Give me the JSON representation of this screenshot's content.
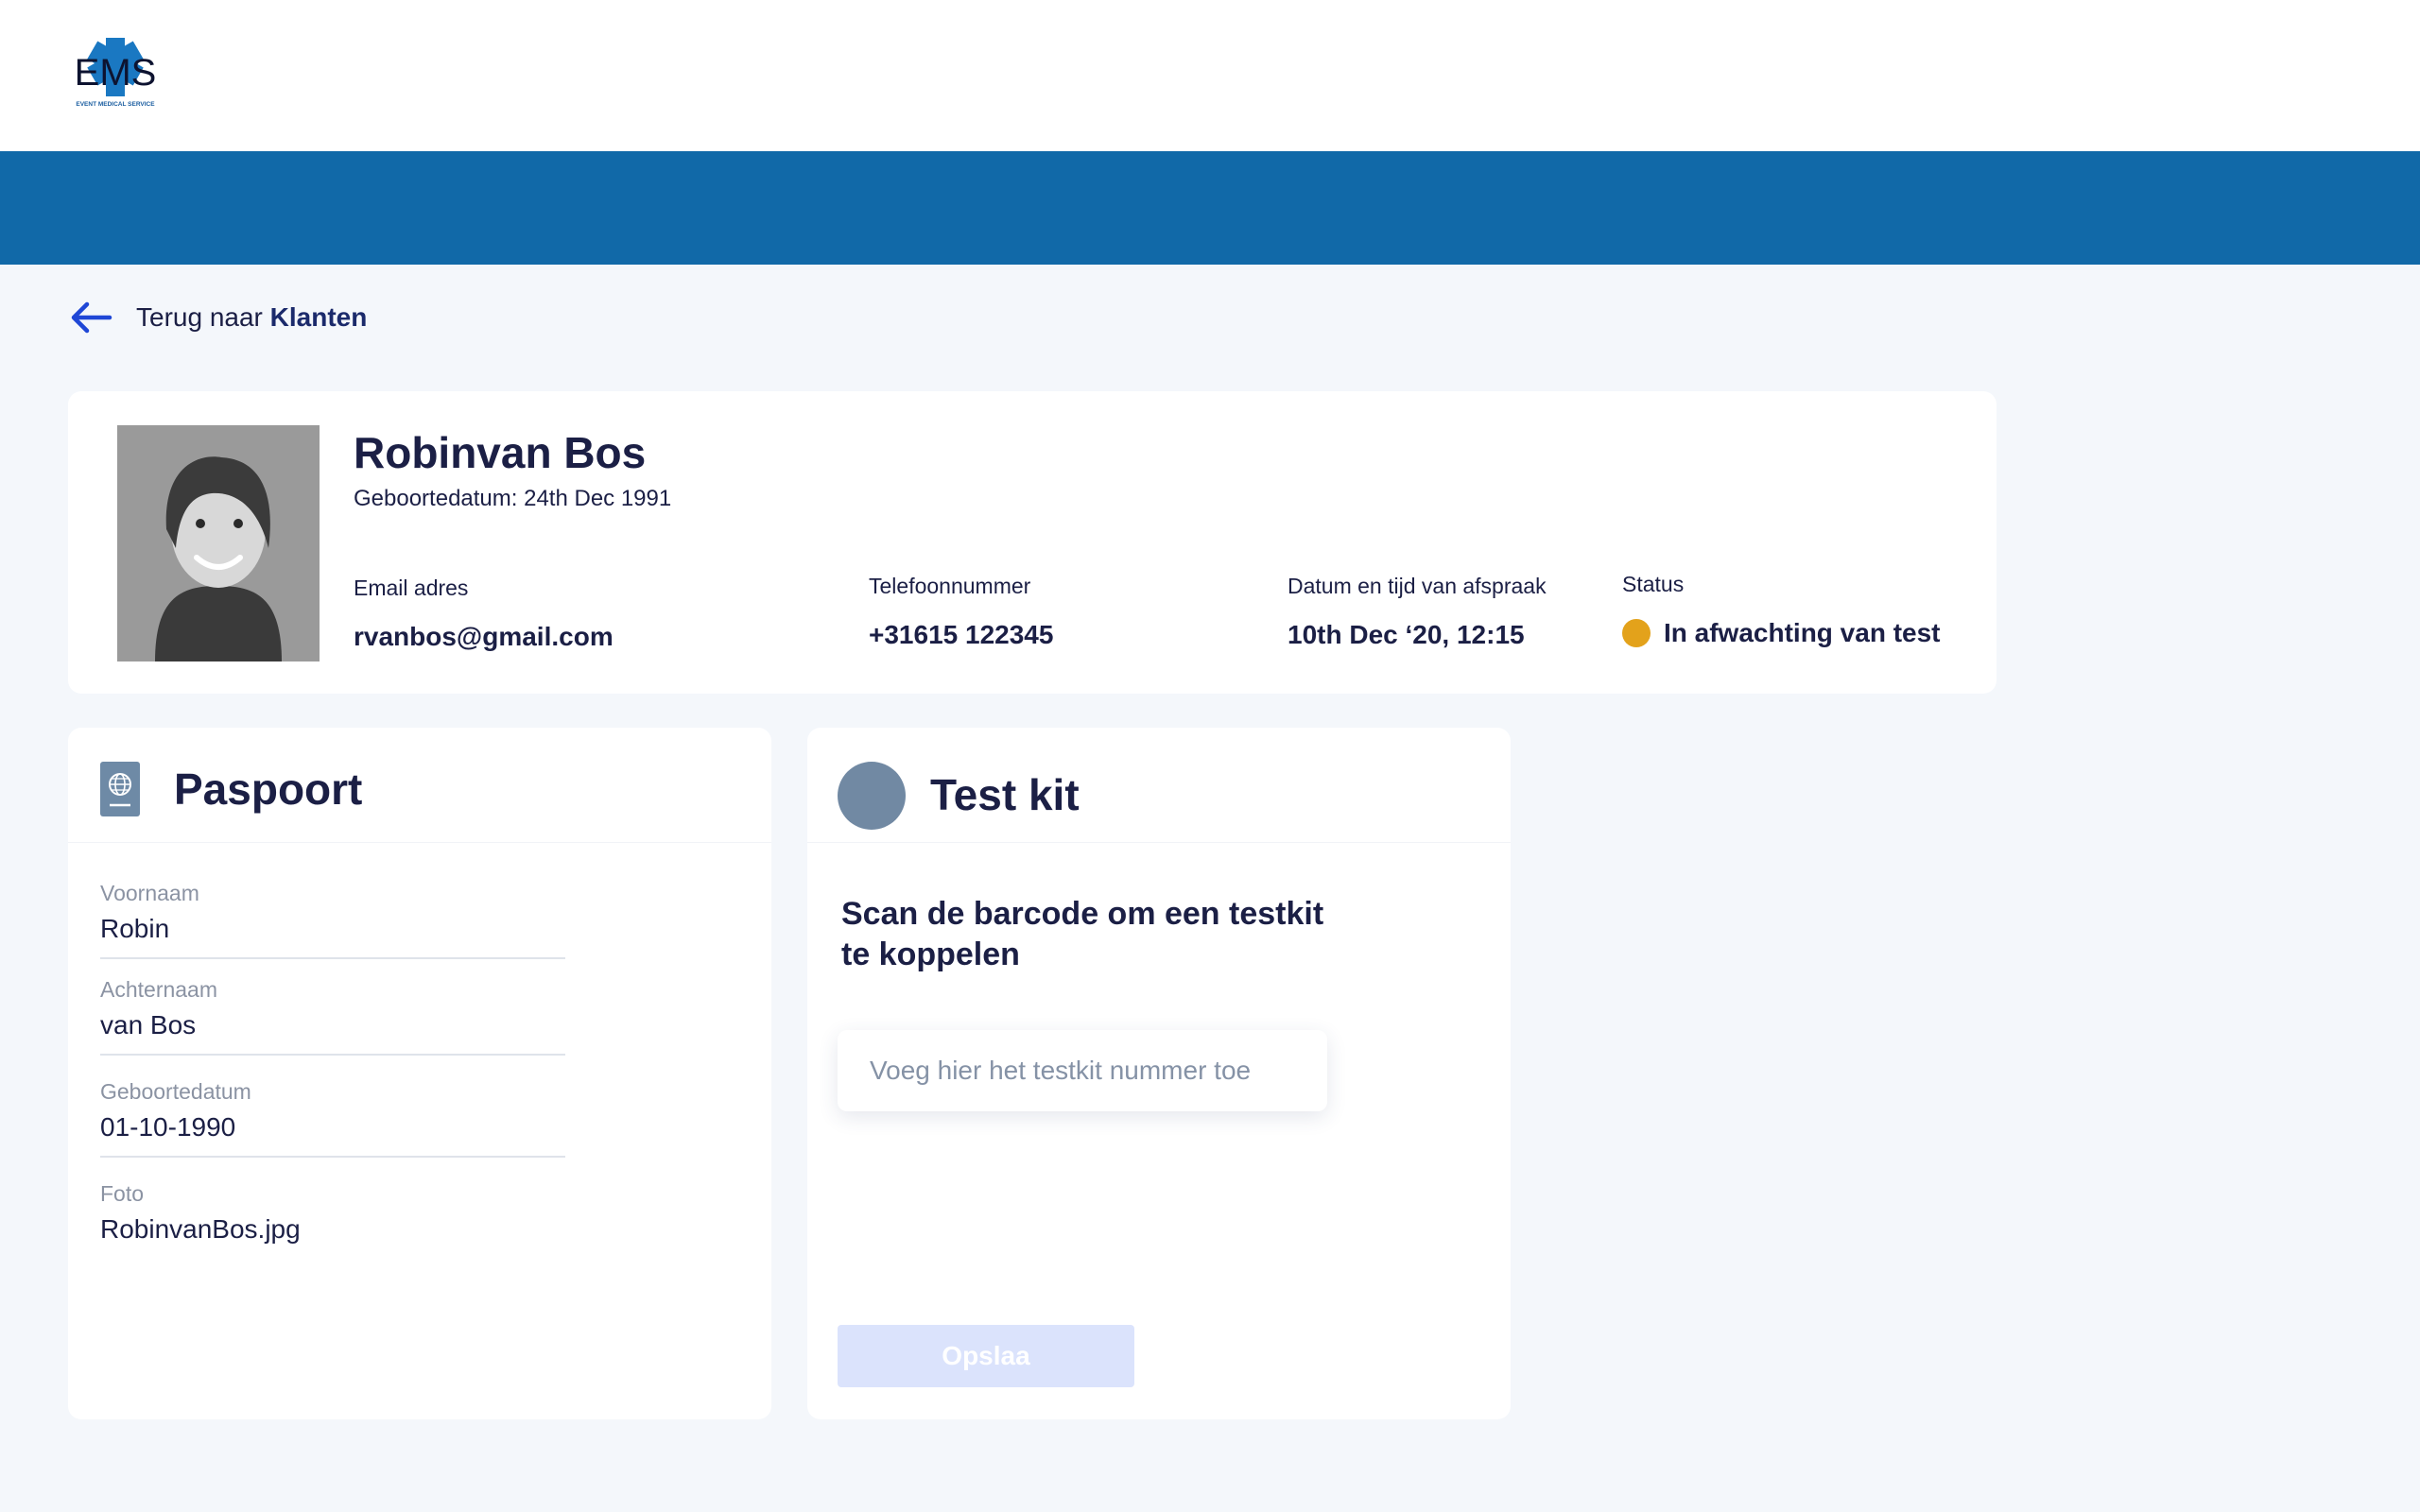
{
  "header": {
    "logo_text": "EMS",
    "logo_subtext": "EVENT MEDICAL SERVICE"
  },
  "back_link": {
    "prefix": "Terug naar",
    "target": "Klanten"
  },
  "profile": {
    "name": "Robinvan Bos",
    "dob_line": "Geboortedatum: 24th Dec  1991",
    "email_label": "Email adres",
    "email_value": "rvanbos@gmail.com",
    "phone_label": "Telefoonnummer",
    "phone_value": "+31615 122345",
    "appointment_label": "Datum en tijd van afspraak",
    "appointment_value": "10th Dec  ‘20, 12:15",
    "status_label": "Status",
    "status_value": "In afwachting van test",
    "status_color": "#e3a21b"
  },
  "passport": {
    "title": "Paspoort",
    "icon": "passport-icon",
    "fields": [
      {
        "label": "Voornaam",
        "value": "Robin"
      },
      {
        "label": "Achternaam",
        "value": "van Bos"
      },
      {
        "label": "Geboortedatum",
        "value": "01-10-1990"
      },
      {
        "label": "Foto",
        "value": "RobinvanBos.jpg"
      }
    ]
  },
  "testkit": {
    "title": "Test kit",
    "heading": "Scan de barcode om een testkit te koppelen",
    "input_placeholder": "Voeg hier het testkit nummer toe",
    "save_label": "Opslaa"
  },
  "colors": {
    "brand_blue": "#1169a8",
    "text_dark": "#1b1f45",
    "background": "#f4f7fb",
    "button_disabled": "#dbe3fc"
  }
}
